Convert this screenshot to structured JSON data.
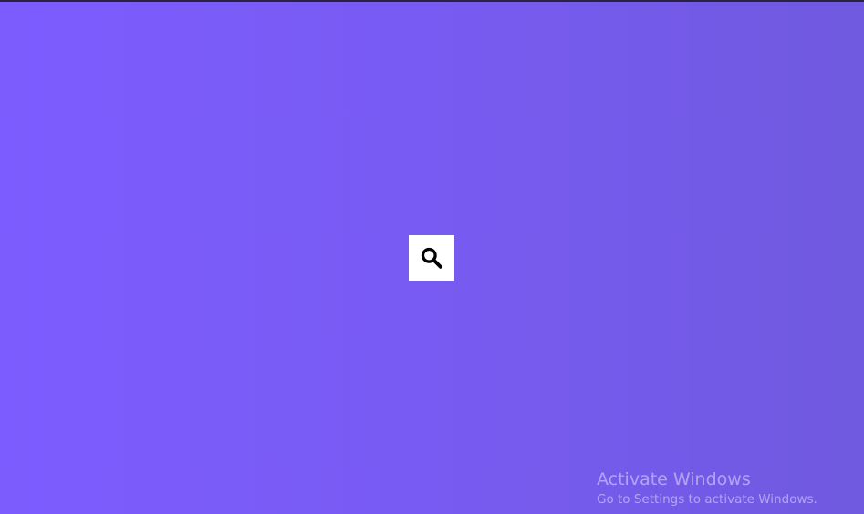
{
  "page": {
    "background_gradient": [
      "#7d5cff",
      "#775bf0",
      "#705adf"
    ],
    "top_border_color": "#2b2240"
  },
  "search": {
    "icon": "search-icon",
    "button_color": "#ffffff",
    "icon_color": "#000000"
  },
  "watermark": {
    "title": "Activate Windows",
    "subtitle": "Go to Settings to activate Windows."
  }
}
